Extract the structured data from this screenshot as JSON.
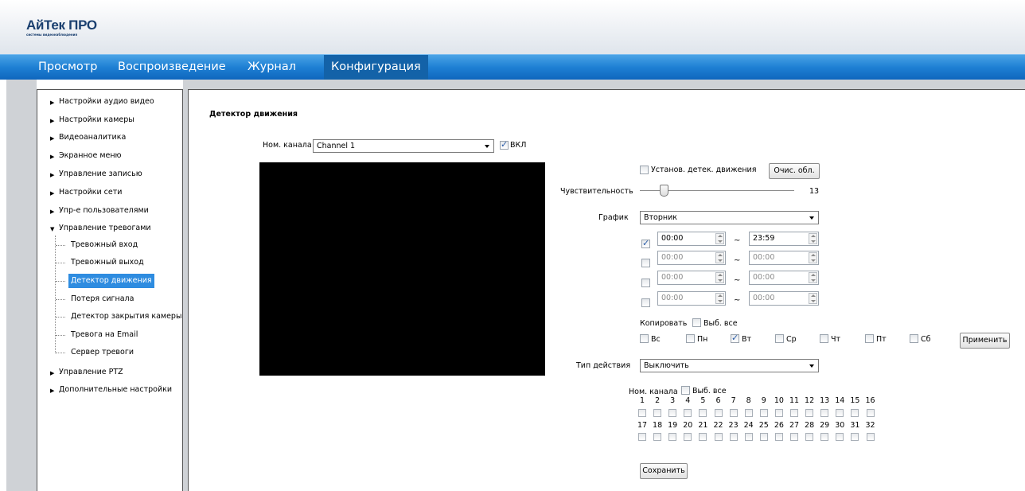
{
  "logo": {
    "main": "АйТек ПРО",
    "sub": "системы видеонаблюдения"
  },
  "nav": [
    "Просмотр",
    "Воспроизведение",
    "Журнал",
    "Конфигурация"
  ],
  "menu": {
    "items": [
      "Настройки аудио видео",
      "Настройки камеры",
      "Видеоаналитика",
      "Экранное меню",
      "Управление записью",
      "Настройки сети",
      "Упр-е пользователями",
      "Управление тревогами"
    ],
    "sub_items": [
      "Тревожный вход",
      "Тревожный выход",
      "Детектор движения",
      "Потеря сигнала",
      "Детектор закрытия камеры",
      "Тревога на Email",
      "Сервер тревоги"
    ],
    "after": [
      "Управление PTZ",
      "Дополнительные настройки"
    ]
  },
  "page": {
    "title": "Детектор движения",
    "channel_label": "Ном. канала",
    "channel_value": "Channel 1",
    "on_label": "ВКЛ",
    "set_detect_label": "Установ. детек. движения",
    "clear_button": "Очис. обл.",
    "sensitivity_label": "Чувствительность",
    "sensitivity_value": "13",
    "schedule_label": "График",
    "schedule_value": "Вторник",
    "times": [
      {
        "from": "00:00",
        "to": "23:59"
      },
      {
        "from": "00:00",
        "to": "00:00"
      },
      {
        "from": "00:00",
        "to": "00:00"
      },
      {
        "from": "00:00",
        "to": "00:00"
      }
    ],
    "tilde": "~",
    "copy_label": "Копировать",
    "select_all": "Выб. все",
    "days": [
      "Вс",
      "Пн",
      "Вт",
      "Ср",
      "Чт",
      "Пт",
      "Сб"
    ],
    "apply_button": "Применить",
    "action_label": "Тип действия",
    "action_value": "Выключить",
    "ch_label": "Ном. канала",
    "ch_numbers_1": [
      "1",
      "2",
      "3",
      "4",
      "5",
      "6",
      "7",
      "8",
      "9",
      "10",
      "11",
      "12",
      "13",
      "14",
      "15",
      "16"
    ],
    "ch_numbers_2": [
      "17",
      "18",
      "19",
      "20",
      "21",
      "22",
      "23",
      "24",
      "25",
      "26",
      "27",
      "28",
      "29",
      "30",
      "31",
      "32"
    ],
    "save_button": "Сохранить"
  }
}
